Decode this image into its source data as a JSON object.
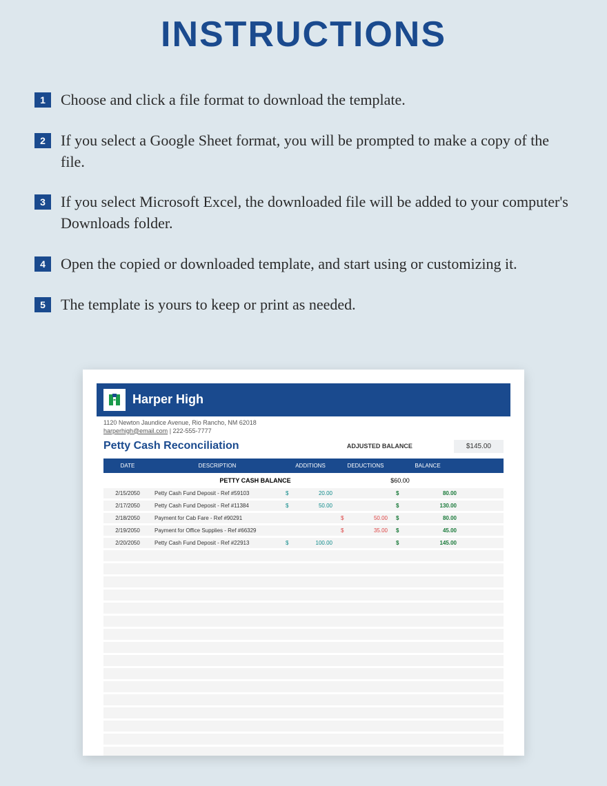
{
  "title": "INSTRUCTIONS",
  "steps": [
    {
      "n": "1",
      "text": "Choose and click a file format to download the template."
    },
    {
      "n": "2",
      "text": "If you select a Google Sheet format, you will be prompted to make a copy of the file."
    },
    {
      "n": "3",
      "text": "If you select Microsoft Excel, the downloaded file will be added to your computer's Downloads folder."
    },
    {
      "n": "4",
      "text": "Open the copied or downloaded template, and start using or customizing it."
    },
    {
      "n": "5",
      "text": "The template is yours to keep or print as needed."
    }
  ],
  "preview": {
    "brand": "Harper High",
    "address": "1120 Newton Jaundice Avenue, Rio Rancho, NM 62018",
    "email": "harperhigh@email.com",
    "phone": "222-555-7777",
    "subtitle": "Petty Cash Reconciliation",
    "adj_label": "ADJUSTED BALANCE",
    "adj_value": "$145.00",
    "headers": {
      "date": "DATE",
      "desc": "DESCRIPTION",
      "add": "ADDITIONS",
      "ded": "DEDUCTIONS",
      "bal": "BALANCE"
    },
    "pcb_label": "PETTY CASH BALANCE",
    "pcb_value": "$60.00",
    "rows": [
      {
        "date": "2/15/2050",
        "desc": "Petty Cash Fund Deposit - Ref #59103",
        "add": "20.00",
        "ded": "",
        "bal": "80.00"
      },
      {
        "date": "2/17/2050",
        "desc": "Petty Cash Fund Deposit - Ref #11384",
        "add": "50.00",
        "ded": "",
        "bal": "130.00"
      },
      {
        "date": "2/18/2050",
        "desc": "Payment for Cab Fare - Ref #90291",
        "add": "",
        "ded": "50.00",
        "bal": "80.00"
      },
      {
        "date": "2/19/2050",
        "desc": "Payment for Office Supplies - Ref #66329",
        "add": "",
        "ded": "35.00",
        "bal": "45.00"
      },
      {
        "date": "2/20/2050",
        "desc": "Petty Cash Fund Deposit - Ref #22913",
        "add": "100.00",
        "ded": "",
        "bal": "145.00"
      }
    ]
  }
}
